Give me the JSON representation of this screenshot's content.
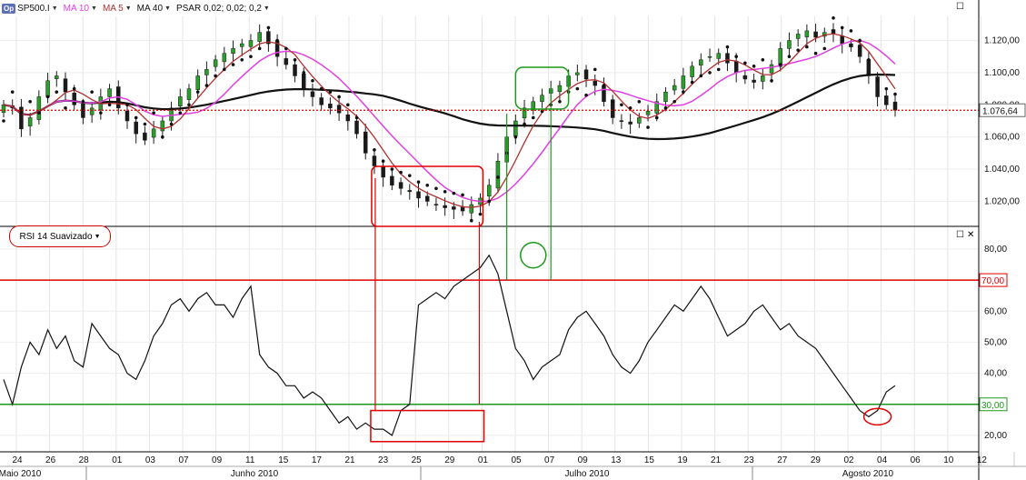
{
  "toolbar": {
    "logo": "Op",
    "symbol": "SP500.I",
    "ma10": "MA 10",
    "ma5": "MA 5",
    "ma40": "MA 40",
    "psar": "PSAR 0,02; 0,02; 0,2",
    "colors": {
      "ma10": "#e040e0",
      "ma5": "#b03030",
      "ma40": "#111111"
    }
  },
  "rsi_panel": {
    "label": "RSI 14 Suavizado"
  },
  "window_buttons": {
    "maximize_icon": "maximize-icon",
    "close_icon": "close-icon",
    "close_glyph": "✕"
  },
  "chart_data": [
    {
      "type": "candlestick",
      "y_ticks": [
        "1.020,00",
        "1.040,00",
        "1.060,00",
        "1.080,00",
        "1.100,00",
        "1.120,00"
      ],
      "ylim": [
        1005,
        1135
      ],
      "current_value_label": "1.076,64",
      "current_value": 1076.64,
      "series": [
        {
          "name": "SP500.I",
          "close": [
            1080,
            1078,
            1065,
            1072,
            1085,
            1095,
            1098,
            1088,
            1080,
            1072,
            1078,
            1085,
            1090,
            1078,
            1070,
            1062,
            1058,
            1065,
            1070,
            1078,
            1085,
            1090,
            1098,
            1102,
            1108,
            1112,
            1115,
            1118,
            1120,
            1125,
            1118,
            1110,
            1105,
            1098,
            1090,
            1085,
            1080,
            1078,
            1075,
            1070,
            1062,
            1050,
            1042,
            1035,
            1030,
            1028,
            1026,
            1022,
            1020,
            1018,
            1016,
            1015,
            1014,
            1018,
            1022,
            1030,
            1045,
            1060,
            1070,
            1078,
            1082,
            1086,
            1090,
            1092,
            1098,
            1100,
            1096,
            1092,
            1082,
            1072,
            1070,
            1068,
            1072,
            1076,
            1082,
            1088,
            1092,
            1098,
            1104,
            1108,
            1110,
            1112,
            1106,
            1100,
            1096,
            1094,
            1098,
            1105,
            1115,
            1120,
            1124,
            1126,
            1122,
            1125,
            1124,
            1118,
            1116,
            1110,
            1098,
            1085,
            1080,
            1076.64
          ]
        },
        {
          "name": "MA 10"
        },
        {
          "name": "MA 5"
        },
        {
          "name": "MA 40"
        },
        {
          "name": "PSAR"
        }
      ]
    },
    {
      "type": "line",
      "series": [
        {
          "name": "RSI 14 Suavizado",
          "values": [
            38,
            30,
            42,
            50,
            46,
            54,
            48,
            52,
            44,
            42,
            56,
            52,
            48,
            46,
            40,
            38,
            44,
            52,
            56,
            62,
            64,
            60,
            64,
            66,
            62,
            62,
            58,
            64,
            68,
            46,
            42,
            40,
            36,
            36,
            32,
            34,
            32,
            28,
            24,
            26,
            22,
            24,
            22,
            22,
            20,
            28,
            30,
            62,
            64,
            66,
            64,
            68,
            70,
            72,
            74,
            78,
            72,
            60,
            48,
            44,
            38,
            42,
            44,
            46,
            54,
            58,
            60,
            56,
            52,
            46,
            42,
            40,
            44,
            50,
            54,
            58,
            62,
            60,
            64,
            68,
            64,
            58,
            52,
            54,
            56,
            60,
            62,
            58,
            54,
            56,
            52,
            50,
            48,
            44,
            40,
            36,
            32,
            28,
            26,
            28,
            34,
            36
          ]
        }
      ],
      "y_ticks": [
        "20,00",
        "30,00",
        "40,00",
        "50,00",
        "60,00",
        "70,00",
        "80,00"
      ],
      "ylim": [
        15,
        87
      ],
      "levels": [
        {
          "value": 70,
          "label": "70,00",
          "color": "#e00000"
        },
        {
          "value": 30,
          "label": "30,00",
          "color": "#1a9a1a"
        }
      ]
    }
  ],
  "x_axis": {
    "day_ticks": [
      "24",
      "26",
      "28",
      "01",
      "03",
      "07",
      "09",
      "11",
      "15",
      "17",
      "21",
      "23",
      "25",
      "29",
      "01",
      "05",
      "07",
      "09",
      "13",
      "15",
      "19",
      "21",
      "23",
      "27",
      "29",
      "02",
      "04",
      "06",
      "10",
      "12"
    ],
    "months": [
      "Maio 2010",
      "Junho 2010",
      "Julho 2010",
      "Agosto 2010"
    ]
  }
}
